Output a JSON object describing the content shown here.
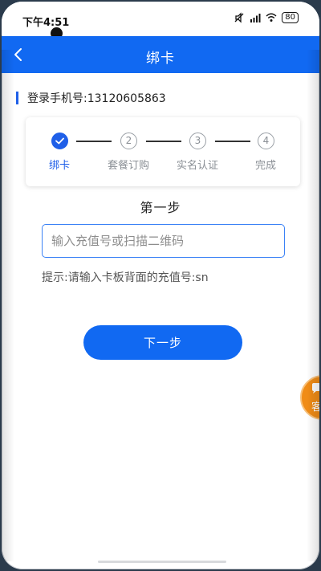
{
  "status_bar": {
    "time": "下午4:51",
    "battery": "80"
  },
  "header": {
    "title": "绑卡",
    "back_icon": "chevron-left-icon"
  },
  "phone_line": {
    "text": "登录手机号:13120605863"
  },
  "steps": [
    {
      "marker": "",
      "label": "绑卡",
      "active": true
    },
    {
      "marker": "2",
      "label": "套餐订购",
      "active": false
    },
    {
      "marker": "3",
      "label": "实名认证",
      "active": false
    },
    {
      "marker": "4",
      "label": "完成",
      "active": false
    }
  ],
  "step_section": {
    "title": "第一步"
  },
  "form": {
    "recharge_value": "",
    "recharge_placeholder": "输入充值号或扫描二维码",
    "hint": "提示:请输入卡板背面的充值号:sn",
    "next_label": "下一步"
  },
  "service_float": {
    "label": "客",
    "icon": "chat-icon"
  },
  "colors": {
    "primary": "#1169f2",
    "active_step": "#1f5fe8",
    "float_button": "#f08c16"
  }
}
